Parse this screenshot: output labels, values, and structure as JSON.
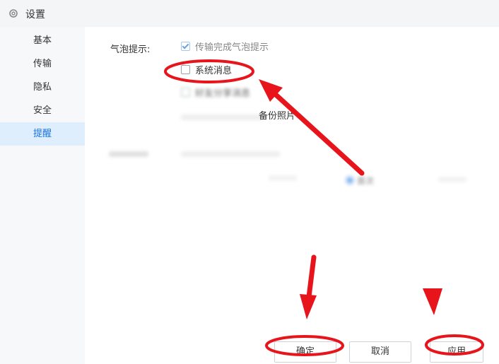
{
  "window": {
    "title": "设置"
  },
  "sidebar": {
    "items": [
      {
        "label": "基本"
      },
      {
        "label": "传输"
      },
      {
        "label": "隐私"
      },
      {
        "label": "安全"
      },
      {
        "label": "提醒",
        "active": true
      }
    ]
  },
  "reminder": {
    "bubble_label": "气泡提示:",
    "options": [
      {
        "label": "传输完成气泡提示",
        "checked": true
      },
      {
        "label": "系统消息",
        "checked": false
      },
      {
        "label": "好友分享消息",
        "checked": false
      }
    ],
    "backup_text": "备份照片",
    "radio_label": "首次"
  },
  "footer": {
    "ok_label": "确定",
    "cancel_label": "取消",
    "apply_label": "应用"
  },
  "colors": {
    "accent": "#1a73e8",
    "sidebar_active_bg": "#dfeefc",
    "annotation_red": "#e8141b"
  }
}
